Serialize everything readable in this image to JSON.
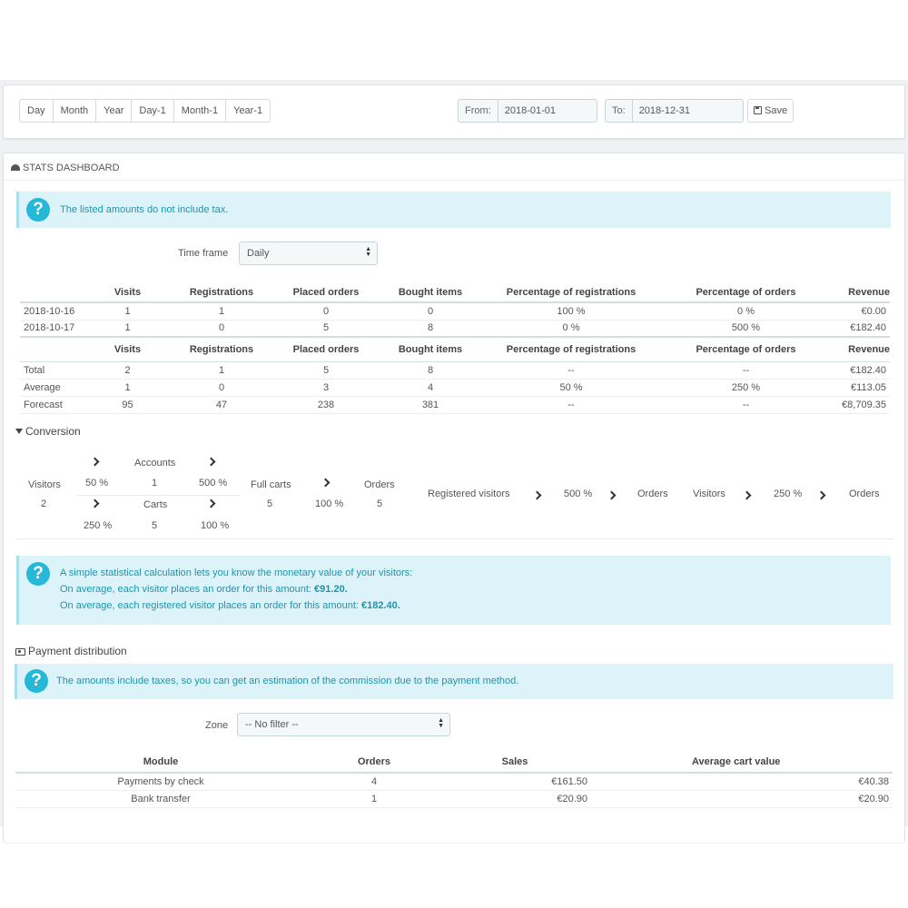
{
  "range_buttons": [
    "Day",
    "Month",
    "Year",
    "Day-1",
    "Month-1",
    "Year-1"
  ],
  "date_range": {
    "from_label": "From:",
    "from_value": "2018-01-01",
    "to_label": "To:",
    "to_value": "2018-12-31",
    "save_label": "Save"
  },
  "panel": {
    "title": "STATS DASHBOARD",
    "tax_notice": "The listed amounts do not include tax.",
    "timeframe_label": "Time frame",
    "timeframe_value": "Daily"
  },
  "stats": {
    "columns": [
      "Visits",
      "Registrations",
      "Placed orders",
      "Bought items",
      "Percentage of registrations",
      "Percentage of orders",
      "Revenue"
    ],
    "rows": [
      {
        "label": "2018-10-16",
        "cells": [
          "1",
          "1",
          "0",
          "0",
          "100 %",
          "0 %",
          "€0.00"
        ]
      },
      {
        "label": "2018-10-17",
        "cells": [
          "1",
          "0",
          "5",
          "8",
          "0 %",
          "500 %",
          "€182.40"
        ]
      }
    ],
    "summary": [
      {
        "label": "Total",
        "cells": [
          "2",
          "1",
          "5",
          "8",
          "--",
          "--",
          "€182.40"
        ]
      },
      {
        "label": "Average",
        "cells": [
          "1",
          "0",
          "3",
          "4",
          "50 %",
          "250 %",
          "€113.05"
        ]
      },
      {
        "label": "Forecast",
        "cells": [
          "95",
          "47",
          "238",
          "381",
          "--",
          "--",
          "€8,709.35"
        ]
      }
    ]
  },
  "conversion": {
    "title": "Conversion",
    "visitors_label": "Visitors",
    "visitors_value": "2",
    "to_accounts_pct": "50 %",
    "accounts_label": "Accounts",
    "accounts_value": "1",
    "accounts_to_full_pct": "500 %",
    "to_carts_pct": "250 %",
    "carts_label": "Carts",
    "carts_value": "5",
    "carts_to_full_pct": "100 %",
    "full_carts_label": "Full carts",
    "full_carts_value": "5",
    "full_to_orders_pct": "100 %",
    "orders_label": "Orders",
    "orders_value": "5",
    "registered_visitors_label": "Registered visitors",
    "registered_pct": "500 %",
    "registered_orders_label": "Orders",
    "visitors2_label": "Visitors",
    "visitors_pct": "250 %",
    "visitors_orders_label": "Orders"
  },
  "value_notice": {
    "line1": "A simple statistical calculation lets you know the monetary value of your visitors:",
    "line2_text": "On average, each visitor places an order for this amount:",
    "line2_amount": "€91.20.",
    "line3_text": "On average, each registered visitor places an order for this amount:",
    "line3_amount": "€182.40."
  },
  "payment": {
    "title": "Payment distribution",
    "notice": "The amounts include taxes, so you can get an estimation of the commission due to the payment method.",
    "zone_label": "Zone",
    "zone_value": "-- No filter --",
    "columns": [
      "Module",
      "Orders",
      "Sales",
      "Average cart value"
    ],
    "rows": [
      {
        "module": "Payments by check",
        "orders": "4",
        "sales": "€161.50",
        "avg": "€40.38"
      },
      {
        "module": "Bank transfer",
        "orders": "1",
        "sales": "€20.90",
        "avg": "€20.90"
      }
    ]
  },
  "colors": {
    "accent": "#25b9d7",
    "alert_bg": "#dcf4f9",
    "alert_text": "#1e94ab"
  }
}
